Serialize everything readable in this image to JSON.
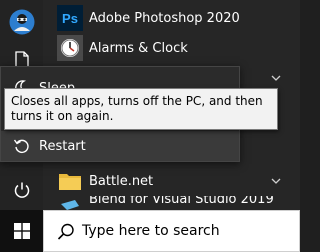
{
  "apps": [
    {
      "label": "Adobe Photoshop 2020",
      "tile_text": "Ps",
      "tile_color": "#001e36",
      "tile_text_color": "#31a8ff"
    },
    {
      "label": "Alarms & Clock",
      "tile_color": "#4a4a4a"
    }
  ],
  "folders": [
    {
      "label": "Battle.net",
      "icon": "folder-icon",
      "color": "#e8b93c"
    },
    {
      "label": "Blend for Visual Studio 2019",
      "icon": "blend-icon"
    }
  ],
  "power_menu": {
    "items": [
      {
        "label": "Sleep",
        "icon": "moon-icon"
      },
      {
        "label": "Restart",
        "icon": "restart-icon"
      }
    ]
  },
  "tooltip": {
    "text": "Closes all apps, turns off the PC, and then turns it on again."
  },
  "taskbar": {
    "search_placeholder": "Type here to search"
  },
  "colors": {
    "accent": "#0078d7",
    "menu_bg": "#262626",
    "taskbar_bg": "#101010"
  }
}
